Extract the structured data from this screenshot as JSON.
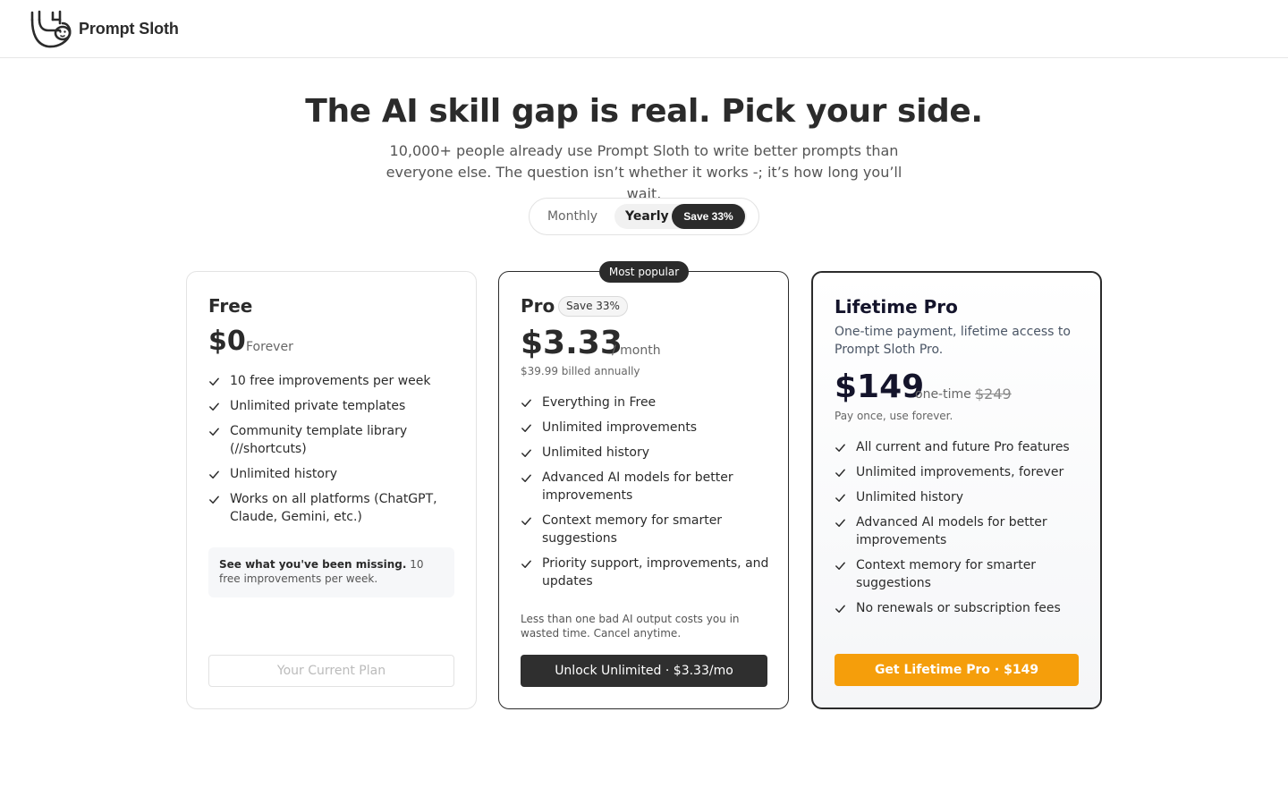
{
  "brand": {
    "name": "Prompt Sloth",
    "logo_icon": "sloth-logo-icon"
  },
  "hero": {
    "title": "The AI skill gap is real. Pick your side.",
    "subtitle_line1": "10,000+ people already use Prompt Sloth to write better prompts than",
    "subtitle_line2": "everyone else. The question isn’t whether it works -; it’s how long you’ll wait."
  },
  "billing_toggle": {
    "monthly_label": "Monthly",
    "yearly_label": "Yearly",
    "yearly_save": "Save 33%",
    "selected": "Yearly"
  },
  "plans": {
    "free": {
      "name": "Free",
      "price": "$0",
      "price_unit": "Forever",
      "features": [
        "10 free improvements per week",
        "Unlimited private templates",
        "Community template library (//shortcuts)",
        "Unlimited history",
        "Works on all platforms (ChatGPT, Claude, Gemini, etc.)"
      ],
      "missing_strong": "See what you've been missing.",
      "missing_rest": " 10 free improvements per week.",
      "button": "Your Current Plan"
    },
    "pro": {
      "badge": "Most popular",
      "name": "Pro",
      "save_pill": "Save 33%",
      "price": "$3.33",
      "price_unit": "/ month",
      "billed_note": "$39.99 billed annually",
      "features": [
        "Everything in Free",
        "Unlimited improvements",
        "Unlimited history",
        "Advanced AI models for better improvements",
        "Context memory for smarter suggestions",
        "Priority support, improvements, and updates"
      ],
      "footnote": "Less than one bad AI output costs you in wasted time. Cancel anytime.",
      "button": "Unlock Unlimited · $3.33/mo"
    },
    "lifetime": {
      "name": "Lifetime Pro",
      "description": "One-time payment, lifetime access to Prompt Sloth Pro.",
      "price": "$149",
      "price_unit": "one-time",
      "old_price": "$249",
      "price_note": "Pay once, use forever.",
      "features": [
        "All current and future Pro features",
        "Unlimited improvements, forever",
        "Unlimited history",
        "Advanced AI models for better improvements",
        "Context memory for smarter suggestions",
        "No renewals or subscription fees"
      ],
      "button": "Get Lifetime Pro · $149"
    }
  },
  "colors": {
    "primary_dark": "#2b2b2b",
    "lifetime_cta": "#f59e0b",
    "border_light": "#e3e3e3"
  }
}
